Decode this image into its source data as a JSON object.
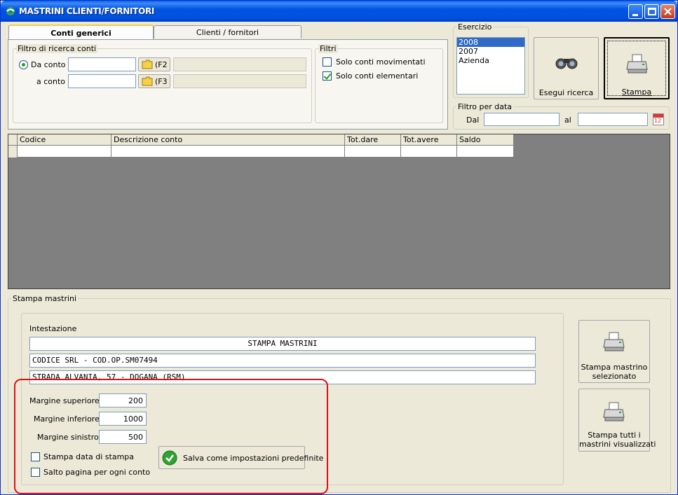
{
  "window": {
    "title": "MASTRINI CLIENTI/FORNITORI"
  },
  "tabs": [
    {
      "label": "Conti generici",
      "active": true
    },
    {
      "label": "Clienti / fornitori",
      "active": false
    }
  ],
  "filtro_ricerca": {
    "group_label": "Filtro di ricerca conti",
    "da_conto_label": "Da conto",
    "a_conto_label": "a conto",
    "da_conto_value": "",
    "a_conto_value": "",
    "f2_label": "(F2",
    "f3_label": "(F3"
  },
  "filtri": {
    "group_label": "Filtri",
    "solo_movimentati": {
      "label": "Solo conti movimentati",
      "checked": false
    },
    "solo_elementari": {
      "label": "Solo conti elementari",
      "checked": true
    }
  },
  "esercizio": {
    "group_label": "Esercizio",
    "items": [
      "2008",
      "2007",
      "Azienda"
    ],
    "selected": "2008"
  },
  "buttons": {
    "esegui_ricerca": "Esegui ricerca",
    "stampa": "Stampa"
  },
  "filtro_data": {
    "group_label": "Filtro per data",
    "dal_label": "Dal",
    "al_label": "al",
    "dal_value": "",
    "al_value": "",
    "calendar_day": "12"
  },
  "grid": {
    "columns": [
      "Codice",
      "Descrizione conto",
      "Tot.dare",
      "Tot.avere",
      "Saldo"
    ]
  },
  "stampa_mastrini": {
    "group_label": "Stampa mastrini",
    "intestazione_label": "Intestazione",
    "intestazione_lines": [
      "STAMPA MASTRINI",
      "CODICE SRL - COD.OP.SM07494",
      "STRADA ALVANIA, 57 - DOGANA (RSM)"
    ],
    "margine_superiore_label": "Margine superiore :",
    "margine_superiore": "200",
    "margine_inferiore_label": "Margine inferiore :",
    "margine_inferiore": "1000",
    "margine_sinistro_label": "Margine sinistro :",
    "margine_sinistro": "500",
    "stampa_data": {
      "label": "Stampa data di stampa",
      "checked": false
    },
    "salto_pagina": {
      "label": "Salto pagina per ogni conto",
      "checked": false
    },
    "salva_button": "Salva come impostazioni predefinite",
    "stampa_selezionato_line1": "Stampa mastrino",
    "stampa_selezionato_line2": "selezionato",
    "stampa_tutti_line1": "Stampa tutti i",
    "stampa_tutti_line2": "mastrini visualizzati"
  }
}
